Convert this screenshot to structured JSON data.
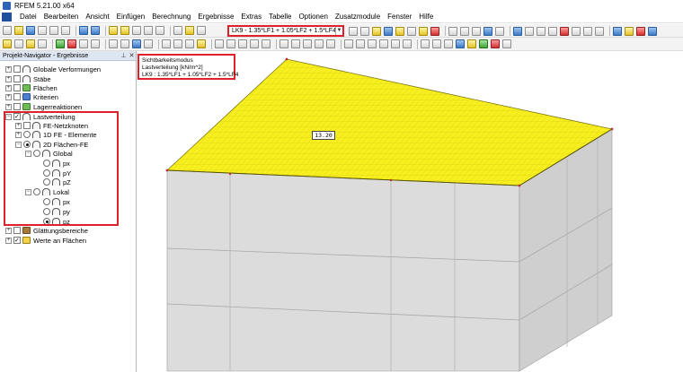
{
  "window": {
    "title": "RFEM 5.21.00 x64"
  },
  "menu": [
    "Datei",
    "Bearbeiten",
    "Ansicht",
    "Einfügen",
    "Berechnung",
    "Ergebnisse",
    "Extras",
    "Tabelle",
    "Optionen",
    "Zusatzmodule",
    "Fenster",
    "Hilfe"
  ],
  "toolbar": {
    "loadcase_value": "LK9 - 1.35*LF1 + 1.05*LF2 + 1.5*LF4",
    "icons": [
      "new-icon",
      "open-icon",
      "save-icon",
      "print-icon",
      "undo-icon",
      "redo-icon",
      "calculate-icon",
      "results-icon",
      "display-icon"
    ]
  },
  "navigator": {
    "title": "Projekt-Navigator - Ergebnisse",
    "items": [
      {
        "label": "Globale Verformungen",
        "level": 0,
        "expander": "+",
        "control": "check",
        "checked": false,
        "icon": "deformation-icon"
      },
      {
        "label": "Stäbe",
        "level": 0,
        "expander": "+",
        "control": "check",
        "checked": false,
        "icon": "member-icon"
      },
      {
        "label": "Flächen",
        "level": 0,
        "expander": "+",
        "control": "check",
        "checked": false,
        "icon": "surface-icon"
      },
      {
        "label": "Kriterien",
        "level": 0,
        "expander": "+",
        "control": "check",
        "checked": false,
        "icon": "criteria-icon"
      },
      {
        "label": "Lagerreaktionen",
        "level": 0,
        "expander": "+",
        "control": "check",
        "checked": false,
        "icon": "support-icon"
      },
      {
        "label": "Lastverteilung",
        "level": 0,
        "expander": "−",
        "control": "check",
        "checked": true,
        "icon": "load-distribution-icon"
      },
      {
        "label": "FE-Netzknoten",
        "level": 1,
        "expander": "+",
        "control": "check",
        "checked": false,
        "icon": "fe-node-icon"
      },
      {
        "label": "1D FE - Elemente",
        "level": 1,
        "expander": "+",
        "control": "radio",
        "checked": false,
        "icon": "fe-element-icon"
      },
      {
        "label": "2D Flächen-FE",
        "level": 1,
        "expander": "−",
        "control": "radio",
        "checked": true,
        "icon": "fe-surface-icon"
      },
      {
        "label": "Global",
        "level": 2,
        "expander": "−",
        "control": "radio",
        "checked": false,
        "icon": "axis-global-icon"
      },
      {
        "label": "px",
        "level": 3,
        "expander": "",
        "control": "radio",
        "checked": false,
        "icon": "px-icon"
      },
      {
        "label": "pY",
        "level": 3,
        "expander": "",
        "control": "radio",
        "checked": false,
        "icon": "py-icon"
      },
      {
        "label": "pZ",
        "level": 3,
        "expander": "",
        "control": "radio",
        "checked": false,
        "icon": "pz-icon"
      },
      {
        "label": "Lokal",
        "level": 2,
        "expander": "−",
        "control": "radio",
        "checked": false,
        "icon": "axis-local-icon"
      },
      {
        "label": "px",
        "level": 3,
        "expander": "",
        "control": "radio",
        "checked": false,
        "icon": "px-icon"
      },
      {
        "label": "py",
        "level": 3,
        "expander": "",
        "control": "radio",
        "checked": false,
        "icon": "py-icon"
      },
      {
        "label": "pz",
        "level": 3,
        "expander": "",
        "control": "radio",
        "checked": true,
        "icon": "pz-icon"
      },
      {
        "label": "Glättungsbereiche",
        "level": 0,
        "expander": "+",
        "control": "check",
        "checked": false,
        "icon": "smoothing-icon"
      },
      {
        "label": "Werte an Flächen",
        "level": 0,
        "expander": "+",
        "control": "check",
        "checked": true,
        "icon": "surface-values-icon"
      }
    ]
  },
  "view": {
    "legend": {
      "line1": "Sichtbarkeitsmodus",
      "line2": "Lastverteilung [kN/m^2]",
      "line3": "LK9 : 1.35*LF1 + 1.05*LF2 + 1.5*LF4"
    },
    "value_label": "13.20",
    "colors": {
      "slab": "#f7ef1e",
      "mesh": "#d4c818",
      "walls": "#dadada",
      "highlight": "#e0202a"
    }
  }
}
